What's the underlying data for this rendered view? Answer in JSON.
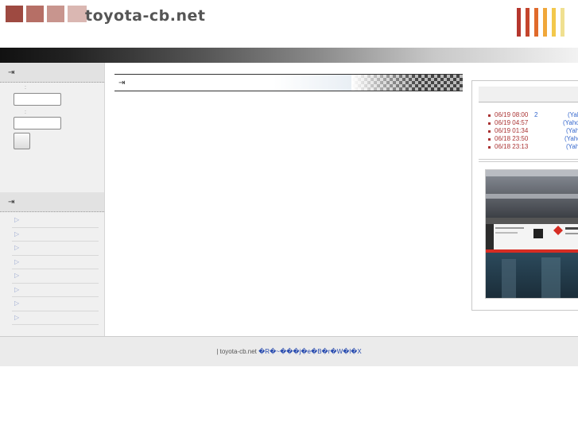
{
  "header": {
    "site_name": "toyota-cb.net",
    "logo_colors": [
      "#9e4a41",
      "#b66f66",
      "#c8958e",
      "#dab7b2"
    ],
    "bar_colors": [
      "#b5362e",
      "#c4452d",
      "#e06a2b",
      "#f0a73a",
      "#f3c84b",
      "#f0e090"
    ]
  },
  "sidebar": {
    "login_field1_label": "　:",
    "login_field2_label": "　:",
    "login_field1_value": "",
    "login_field2_value": "",
    "login_button_label": "",
    "menu_items": [
      "",
      "",
      "",
      "",
      "",
      "",
      "",
      ""
    ]
  },
  "main": {
    "heading": ""
  },
  "news": {
    "items": [
      {
        "date": "06/19 08:00",
        "count": "2",
        "source": "(Yah"
      },
      {
        "date": "06/19 04:57",
        "count": "",
        "source": "(Yaho"
      },
      {
        "date": "06/19 01:34",
        "count": "",
        "source": "(Yah"
      },
      {
        "date": "06/18 23:50",
        "count": "",
        "source": "(Yaho"
      },
      {
        "date": "06/18 23:13",
        "count": "",
        "source": "(Yah"
      }
    ]
  },
  "footer": {
    "prefix": "| toyota-cb.net ",
    "link_text": "�R�~���j�e�B�r�W�l�X"
  }
}
